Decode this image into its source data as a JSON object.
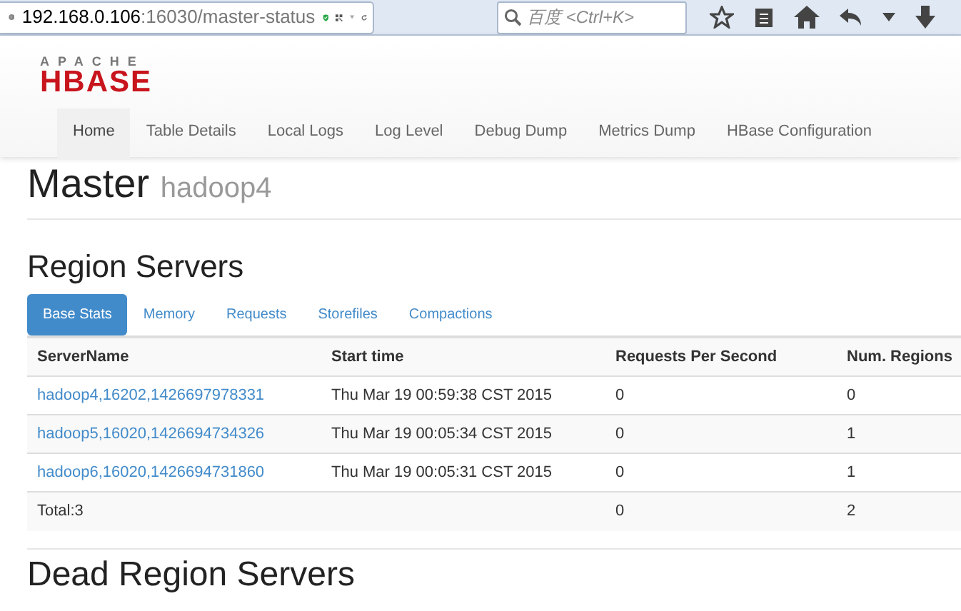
{
  "browser": {
    "url_host": "192.168.0.106",
    "url_path": ":16030/master-status",
    "search_placeholder": "百度 <Ctrl+K>"
  },
  "navbar": {
    "logo_top": "APACHE",
    "logo_main": "HBASE",
    "items": [
      {
        "label": "Home",
        "selected": true
      },
      {
        "label": "Table Details",
        "selected": false
      },
      {
        "label": "Local Logs",
        "selected": false
      },
      {
        "label": "Log Level",
        "selected": false
      },
      {
        "label": "Debug Dump",
        "selected": false
      },
      {
        "label": "Metrics Dump",
        "selected": false
      },
      {
        "label": "HBase Configuration",
        "selected": false
      }
    ]
  },
  "master": {
    "title": "Master",
    "host": "hadoop4"
  },
  "region_servers": {
    "title": "Region Servers",
    "tabs": [
      {
        "label": "Base Stats",
        "selected": true
      },
      {
        "label": "Memory",
        "selected": false
      },
      {
        "label": "Requests",
        "selected": false
      },
      {
        "label": "Storefiles",
        "selected": false
      },
      {
        "label": "Compactions",
        "selected": false
      }
    ],
    "table": {
      "columns": [
        "ServerName",
        "Start time",
        "Requests Per Second",
        "Num. Regions"
      ],
      "rows": [
        {
          "server": "hadoop4,16202,1426697978331",
          "start_time": "Thu Mar 19 00:59:38 CST 2015",
          "requests_per_second": "0",
          "num_regions": "0"
        },
        {
          "server": "hadoop5,16020,1426694734326",
          "start_time": "Thu Mar 19 00:05:34 CST 2015",
          "requests_per_second": "0",
          "num_regions": "1"
        },
        {
          "server": "hadoop6,16020,1426694731860",
          "start_time": "Thu Mar 19 00:05:31 CST 2015",
          "requests_per_second": "0",
          "num_regions": "1"
        }
      ],
      "total": {
        "label": "Total:3",
        "requests_per_second": "0",
        "num_regions": "2"
      }
    }
  },
  "dead_region_servers": {
    "title": "Dead Region Servers"
  }
}
